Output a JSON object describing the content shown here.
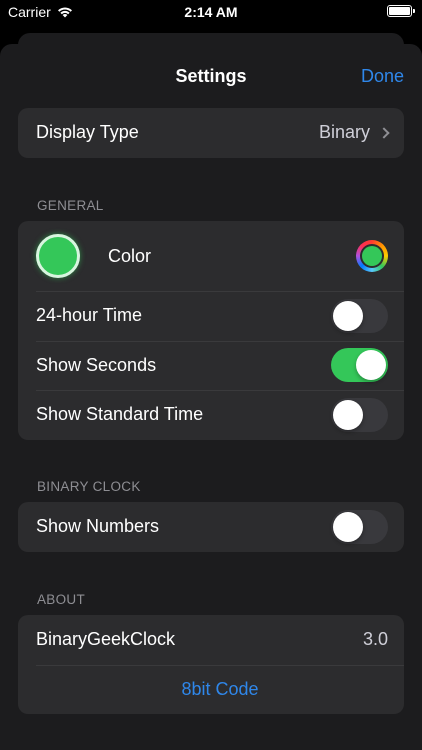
{
  "status": {
    "carrier": "Carrier",
    "time": "2:14 AM"
  },
  "nav": {
    "title": "Settings",
    "done_label": "Done"
  },
  "display": {
    "label": "Display Type",
    "value": "Binary"
  },
  "general": {
    "header": "GENERAL",
    "color_label": "Color",
    "color_value": "#34c759",
    "time24_label": "24-hour Time",
    "time24_on": false,
    "seconds_label": "Show Seconds",
    "seconds_on": true,
    "standard_label": "Show Standard Time",
    "standard_on": false
  },
  "binary": {
    "header": "BINARY CLOCK",
    "numbers_label": "Show Numbers",
    "numbers_on": false
  },
  "about": {
    "header": "ABOUT",
    "app_name": "BinaryGeekClock",
    "version": "3.0",
    "link_label": "8bit Code"
  },
  "colors": {
    "accent": "#2f87ea",
    "toggle_on": "#34c759",
    "background": "#1c1c1e",
    "group": "#2c2c2e"
  }
}
